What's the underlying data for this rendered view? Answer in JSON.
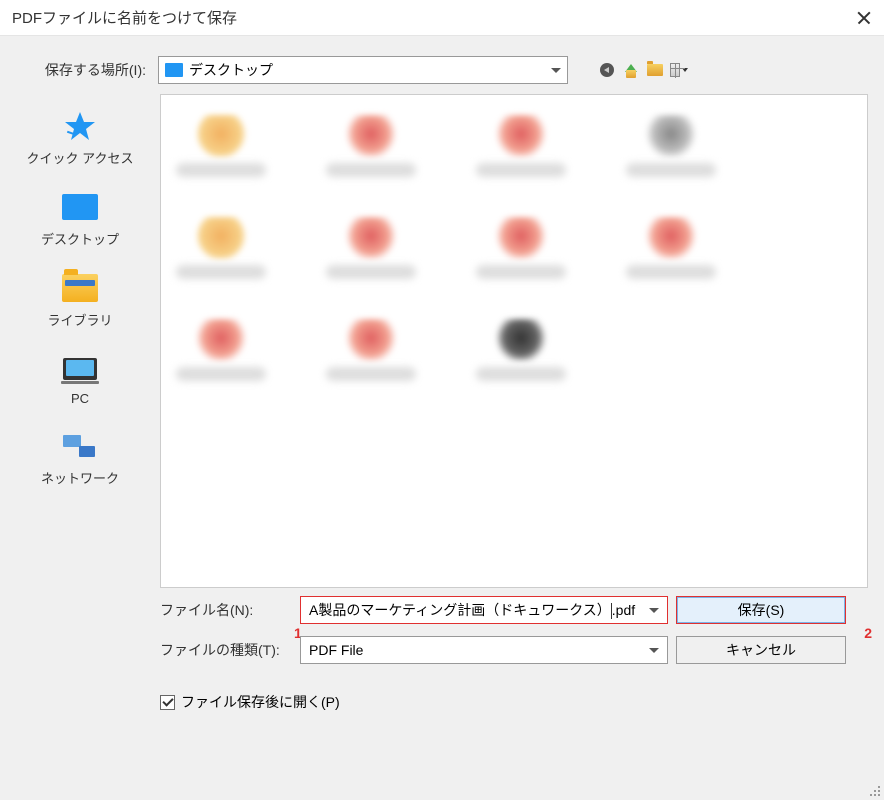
{
  "titlebar": {
    "title": "PDFファイルに名前をつけて保存"
  },
  "toolbar": {
    "location_label": "保存する場所(I):",
    "location_value": "デスクトップ"
  },
  "sidebar": {
    "items": [
      {
        "label": "クイック アクセス"
      },
      {
        "label": "デスクトップ"
      },
      {
        "label": "ライブラリ"
      },
      {
        "label": "PC"
      },
      {
        "label": "ネットワーク"
      }
    ]
  },
  "form": {
    "filename_label": "ファイル名(N):",
    "filename_value_pre": "A製品のマーケティング計画（ドキュワークス）",
    "filename_value_ext": ".pdf",
    "filetype_label": "ファイルの種類(T):",
    "filetype_value": "PDF File",
    "save_label": "保存(S)",
    "cancel_label": "キャンセル",
    "open_after_label": "ファイル保存後に開く(P)"
  },
  "callouts": {
    "one": "1",
    "two": "2"
  }
}
